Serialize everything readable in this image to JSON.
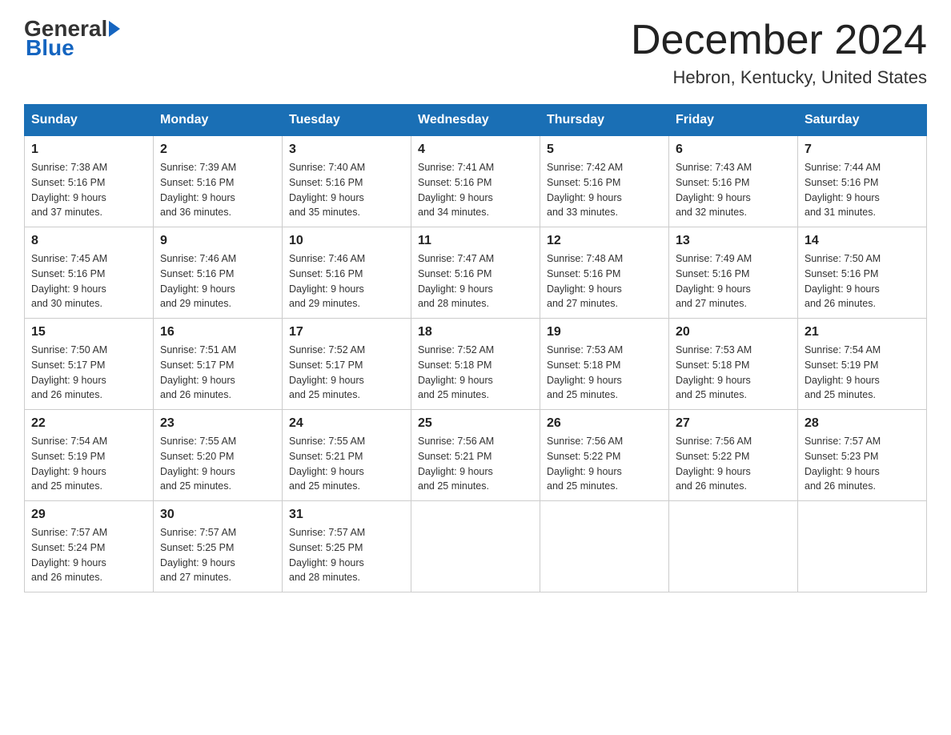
{
  "header": {
    "logo_general": "General",
    "logo_blue": "Blue",
    "month_title": "December 2024",
    "location": "Hebron, Kentucky, United States"
  },
  "days_of_week": [
    "Sunday",
    "Monday",
    "Tuesday",
    "Wednesday",
    "Thursday",
    "Friday",
    "Saturday"
  ],
  "weeks": [
    [
      {
        "day": "1",
        "sunrise": "7:38 AM",
        "sunset": "5:16 PM",
        "daylight": "9 hours and 37 minutes."
      },
      {
        "day": "2",
        "sunrise": "7:39 AM",
        "sunset": "5:16 PM",
        "daylight": "9 hours and 36 minutes."
      },
      {
        "day": "3",
        "sunrise": "7:40 AM",
        "sunset": "5:16 PM",
        "daylight": "9 hours and 35 minutes."
      },
      {
        "day": "4",
        "sunrise": "7:41 AM",
        "sunset": "5:16 PM",
        "daylight": "9 hours and 34 minutes."
      },
      {
        "day": "5",
        "sunrise": "7:42 AM",
        "sunset": "5:16 PM",
        "daylight": "9 hours and 33 minutes."
      },
      {
        "day": "6",
        "sunrise": "7:43 AM",
        "sunset": "5:16 PM",
        "daylight": "9 hours and 32 minutes."
      },
      {
        "day": "7",
        "sunrise": "7:44 AM",
        "sunset": "5:16 PM",
        "daylight": "9 hours and 31 minutes."
      }
    ],
    [
      {
        "day": "8",
        "sunrise": "7:45 AM",
        "sunset": "5:16 PM",
        "daylight": "9 hours and 30 minutes."
      },
      {
        "day": "9",
        "sunrise": "7:46 AM",
        "sunset": "5:16 PM",
        "daylight": "9 hours and 29 minutes."
      },
      {
        "day": "10",
        "sunrise": "7:46 AM",
        "sunset": "5:16 PM",
        "daylight": "9 hours and 29 minutes."
      },
      {
        "day": "11",
        "sunrise": "7:47 AM",
        "sunset": "5:16 PM",
        "daylight": "9 hours and 28 minutes."
      },
      {
        "day": "12",
        "sunrise": "7:48 AM",
        "sunset": "5:16 PM",
        "daylight": "9 hours and 27 minutes."
      },
      {
        "day": "13",
        "sunrise": "7:49 AM",
        "sunset": "5:16 PM",
        "daylight": "9 hours and 27 minutes."
      },
      {
        "day": "14",
        "sunrise": "7:50 AM",
        "sunset": "5:16 PM",
        "daylight": "9 hours and 26 minutes."
      }
    ],
    [
      {
        "day": "15",
        "sunrise": "7:50 AM",
        "sunset": "5:17 PM",
        "daylight": "9 hours and 26 minutes."
      },
      {
        "day": "16",
        "sunrise": "7:51 AM",
        "sunset": "5:17 PM",
        "daylight": "9 hours and 26 minutes."
      },
      {
        "day": "17",
        "sunrise": "7:52 AM",
        "sunset": "5:17 PM",
        "daylight": "9 hours and 25 minutes."
      },
      {
        "day": "18",
        "sunrise": "7:52 AM",
        "sunset": "5:18 PM",
        "daylight": "9 hours and 25 minutes."
      },
      {
        "day": "19",
        "sunrise": "7:53 AM",
        "sunset": "5:18 PM",
        "daylight": "9 hours and 25 minutes."
      },
      {
        "day": "20",
        "sunrise": "7:53 AM",
        "sunset": "5:18 PM",
        "daylight": "9 hours and 25 minutes."
      },
      {
        "day": "21",
        "sunrise": "7:54 AM",
        "sunset": "5:19 PM",
        "daylight": "9 hours and 25 minutes."
      }
    ],
    [
      {
        "day": "22",
        "sunrise": "7:54 AM",
        "sunset": "5:19 PM",
        "daylight": "9 hours and 25 minutes."
      },
      {
        "day": "23",
        "sunrise": "7:55 AM",
        "sunset": "5:20 PM",
        "daylight": "9 hours and 25 minutes."
      },
      {
        "day": "24",
        "sunrise": "7:55 AM",
        "sunset": "5:21 PM",
        "daylight": "9 hours and 25 minutes."
      },
      {
        "day": "25",
        "sunrise": "7:56 AM",
        "sunset": "5:21 PM",
        "daylight": "9 hours and 25 minutes."
      },
      {
        "day": "26",
        "sunrise": "7:56 AM",
        "sunset": "5:22 PM",
        "daylight": "9 hours and 25 minutes."
      },
      {
        "day": "27",
        "sunrise": "7:56 AM",
        "sunset": "5:22 PM",
        "daylight": "9 hours and 26 minutes."
      },
      {
        "day": "28",
        "sunrise": "7:57 AM",
        "sunset": "5:23 PM",
        "daylight": "9 hours and 26 minutes."
      }
    ],
    [
      {
        "day": "29",
        "sunrise": "7:57 AM",
        "sunset": "5:24 PM",
        "daylight": "9 hours and 26 minutes."
      },
      {
        "day": "30",
        "sunrise": "7:57 AM",
        "sunset": "5:25 PM",
        "daylight": "9 hours and 27 minutes."
      },
      {
        "day": "31",
        "sunrise": "7:57 AM",
        "sunset": "5:25 PM",
        "daylight": "9 hours and 28 minutes."
      },
      null,
      null,
      null,
      null
    ]
  ],
  "labels": {
    "sunrise": "Sunrise:",
    "sunset": "Sunset:",
    "daylight": "Daylight:"
  }
}
